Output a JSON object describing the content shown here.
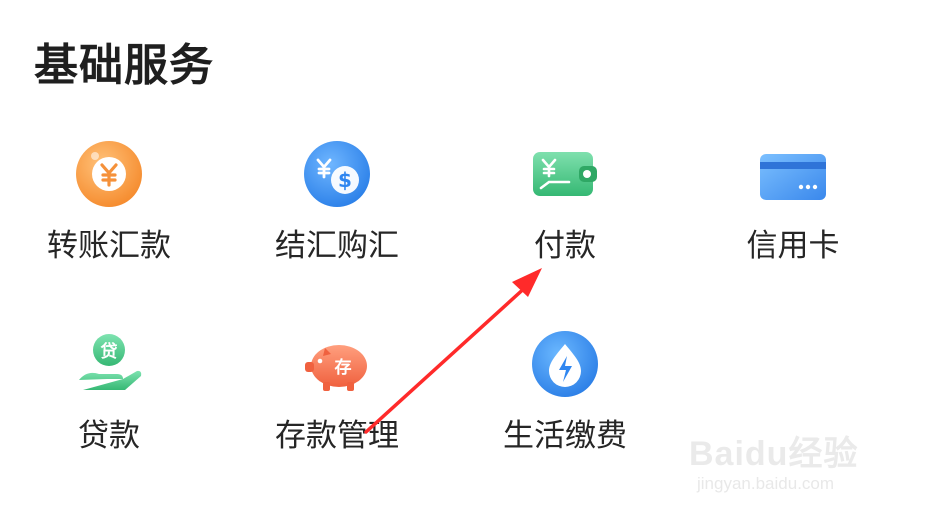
{
  "section": {
    "title": "基础服务"
  },
  "services": [
    {
      "label": "转账汇款",
      "icon": "yuan-coin-icon"
    },
    {
      "label": "结汇购汇",
      "icon": "currency-exchange-icon"
    },
    {
      "label": "付款",
      "icon": "wallet-payment-icon"
    },
    {
      "label": "信用卡",
      "icon": "credit-card-icon"
    },
    {
      "label": "贷款",
      "icon": "loan-hand-icon"
    },
    {
      "label": "存款管理",
      "icon": "piggy-bank-icon"
    },
    {
      "label": "生活缴费",
      "icon": "utility-bolt-icon"
    }
  ],
  "piggy_label": "存",
  "loan_label": "贷",
  "watermark": {
    "brand": "Baidu经验",
    "url": "jingyan.baidu.com"
  },
  "colors": {
    "orange": "#f5913a",
    "blue": "#2f86f0",
    "green": "#3cbf7a",
    "card_blue": "#4a9af2",
    "piggy": "#f26a4b",
    "arrow": "#ff2a2a"
  }
}
